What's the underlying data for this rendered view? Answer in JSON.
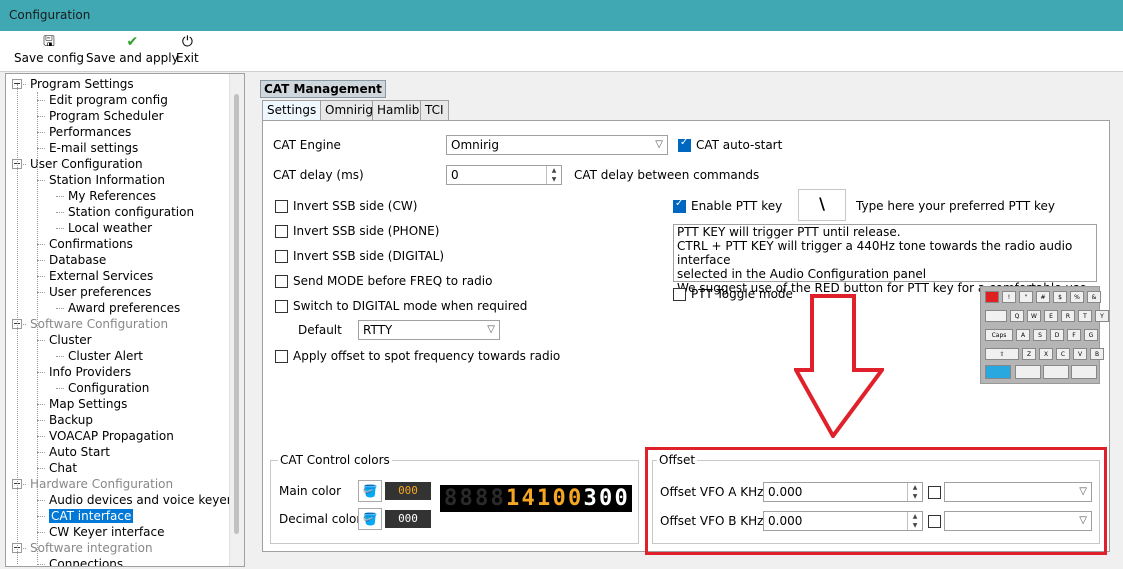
{
  "window": {
    "title": "Configuration"
  },
  "toolbar": {
    "save_config": {
      "label": "Save config",
      "icon": "save-icon"
    },
    "save_and_apply": {
      "label": "Save and apply",
      "icon": "check-icon"
    },
    "exit": {
      "label": "Exit",
      "icon": "power-icon"
    }
  },
  "tree": [
    {
      "label": "Program Settings",
      "level": 0,
      "gray": false
    },
    {
      "label": "Edit program config",
      "level": 1,
      "gray": false
    },
    {
      "label": "Program Scheduler",
      "level": 1,
      "gray": false
    },
    {
      "label": "Performances",
      "level": 1,
      "gray": false
    },
    {
      "label": "E-mail settings",
      "level": 1,
      "gray": false
    },
    {
      "label": "User Configuration",
      "level": 0,
      "gray": false
    },
    {
      "label": "Station Information",
      "level": 1,
      "gray": false
    },
    {
      "label": "My References",
      "level": 2,
      "gray": false
    },
    {
      "label": "Station configuration",
      "level": 2,
      "gray": false
    },
    {
      "label": "Local weather",
      "level": 2,
      "gray": false
    },
    {
      "label": "Confirmations",
      "level": 1,
      "gray": false
    },
    {
      "label": "Database",
      "level": 1,
      "gray": false
    },
    {
      "label": "External Services",
      "level": 1,
      "gray": false
    },
    {
      "label": "User preferences",
      "level": 1,
      "gray": false
    },
    {
      "label": "Award preferences",
      "level": 2,
      "gray": false
    },
    {
      "label": "Software Configuration",
      "level": 0,
      "gray": true
    },
    {
      "label": "Cluster",
      "level": 1,
      "gray": false
    },
    {
      "label": "Cluster Alert",
      "level": 2,
      "gray": false
    },
    {
      "label": "Info Providers",
      "level": 1,
      "gray": false
    },
    {
      "label": "Configuration",
      "level": 2,
      "gray": false
    },
    {
      "label": "Map Settings",
      "level": 1,
      "gray": false
    },
    {
      "label": "Backup",
      "level": 1,
      "gray": false
    },
    {
      "label": "VOACAP Propagation",
      "level": 1,
      "gray": false
    },
    {
      "label": "Auto Start",
      "level": 1,
      "gray": false
    },
    {
      "label": "Chat",
      "level": 1,
      "gray": false
    },
    {
      "label": "Hardware Configuration",
      "level": 0,
      "gray": true
    },
    {
      "label": "Audio devices and voice keyer",
      "level": 1,
      "gray": false
    },
    {
      "label": "CAT interface",
      "level": 1,
      "gray": false,
      "selected": true
    },
    {
      "label": "CW Keyer interface",
      "level": 1,
      "gray": false
    },
    {
      "label": "Software integration",
      "level": 0,
      "gray": true
    },
    {
      "label": "Connections",
      "level": 1,
      "gray": false
    }
  ],
  "section_title": "CAT Management",
  "tabs": [
    "Settings",
    "Omnirig",
    "Hamlib",
    "TCI"
  ],
  "settings": {
    "cat_engine_label": "CAT Engine",
    "cat_engine_value": "Omnirig",
    "cat_autostart_label": "CAT auto-start",
    "cat_autostart_checked": true,
    "cat_delay_label": "CAT delay (ms)",
    "cat_delay_value": "0",
    "cat_delay_hint": "CAT delay between commands",
    "invert_ssb_cw": "Invert SSB side (CW)",
    "invert_ssb_phone": "Invert SSB side (PHONE)",
    "invert_ssb_digital": "Invert SSB side (DIGITAL)",
    "send_mode": "Send MODE before FREQ to radio",
    "switch_digital": "Switch to DIGITAL mode when required",
    "default_label": "Default",
    "default_value": "RTTY",
    "apply_offset": "Apply offset to spot frequency towards radio",
    "enable_ptt_label": "Enable PTT key",
    "enable_ptt_checked": true,
    "ptt_key_value": "\\",
    "ptt_key_hint": "Type here your preferred PTT key",
    "ptt_info": [
      "PTT KEY will trigger PTT until release.",
      "CTRL + PTT KEY will trigger a 440Hz tone towards the radio audio interface",
      "selected in the Audio Configuration panel",
      "We suggest use of the RED button for PTT key for a comfortable use"
    ],
    "ptt_toggle_label": "PTT Toggle mode"
  },
  "colors_group": {
    "title": "CAT Control colors",
    "main_label": "Main color",
    "main_value": "000",
    "main_color": "#f5a623",
    "decimal_label": "Decimal color",
    "decimal_value": "000",
    "decimal_color": "#ffffff",
    "display": "14100300"
  },
  "offset_group": {
    "title": "Offset",
    "vfo_a_label": "Offset VFO A KHz",
    "vfo_a_value": "0.000",
    "vfo_b_label": "Offset VFO B KHz",
    "vfo_b_value": "0.000"
  },
  "keyboard": {
    "row1": [
      "",
      "!",
      "\"",
      "#",
      "$",
      "%",
      "&"
    ],
    "row2": [
      "",
      "Q",
      "W",
      "E",
      "R",
      "T",
      "Y"
    ],
    "row3": [
      "Caps",
      "A",
      "S",
      "D",
      "F",
      "G"
    ],
    "row4": [
      "⇧",
      "Z",
      "X",
      "C",
      "V",
      "B"
    ]
  },
  "colors": {
    "titlebar": "#3fa8b3",
    "selection": "#0078d7",
    "highlight": "#e0202a",
    "ptt_key": "#e02020",
    "space_key": "#29a8e0"
  }
}
